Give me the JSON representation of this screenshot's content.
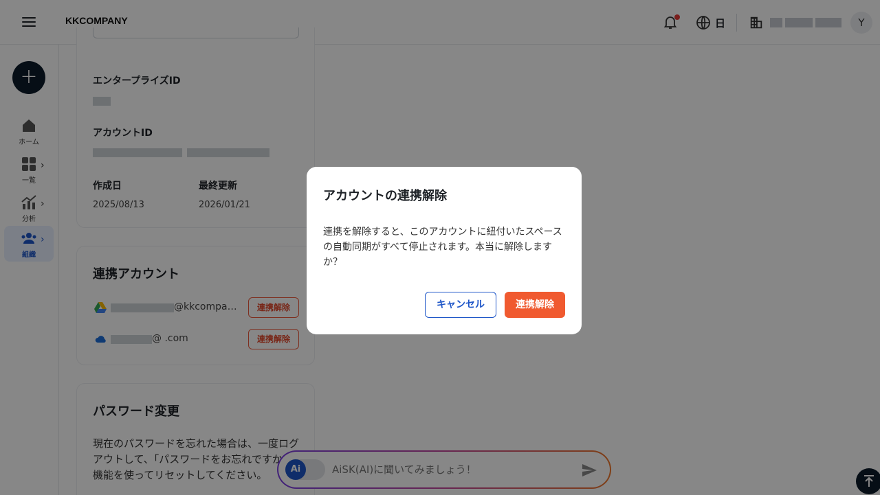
{
  "header": {
    "logo": "KKCOMPANY",
    "lang": "日",
    "avatar_initial": "Y"
  },
  "sidebar": {
    "items": [
      {
        "label": "ホーム"
      },
      {
        "label": "一覧"
      },
      {
        "label": "分析"
      },
      {
        "label": "組織"
      }
    ]
  },
  "profile": {
    "enterprise_id_label": "エンタープライズID",
    "account_id_label": "アカウントID",
    "created_label": "作成日",
    "created_value": "2025/08/13",
    "updated_label": "最終更新",
    "updated_value": "2026/01/21"
  },
  "linked": {
    "title": "連携アカウント",
    "accounts": [
      {
        "email": "@kkcompan…",
        "button": "連携解除"
      },
      {
        "email": "@   .com",
        "button": "連携解除"
      }
    ]
  },
  "password": {
    "title": "パスワード変更",
    "text": "現在のパスワードを忘れた場合は、一度ログアウトして、「パスワードをお忘れですか」機能を使ってリセットしてください。"
  },
  "ai": {
    "badge": "Ai",
    "placeholder": "AiSK(AI)に聞いてみましょう！"
  },
  "dialog": {
    "title": "アカウントの連携解除",
    "body": "連携を解除すると、このアカウントに紐付いたスペースの自動同期がすべて停止されます。本当に解除しますか？",
    "cancel": "キャンセル",
    "confirm": "連携解除"
  },
  "colors": {
    "accent": "#1e56c8",
    "danger": "#f05a30"
  }
}
